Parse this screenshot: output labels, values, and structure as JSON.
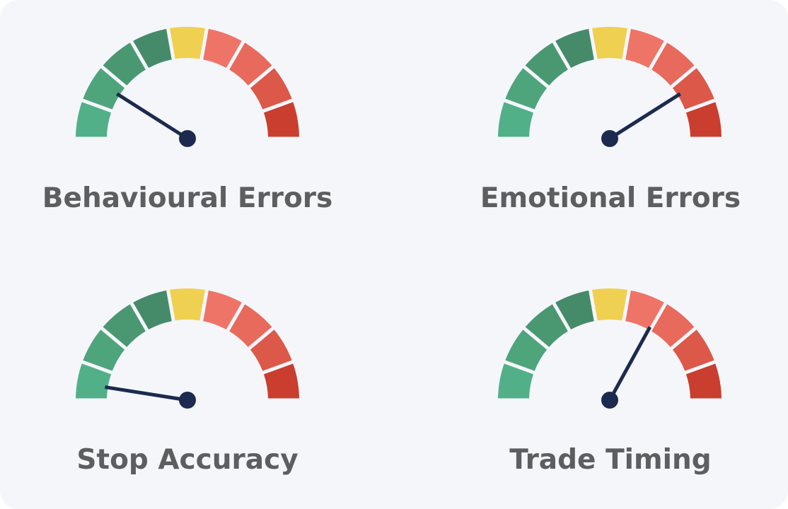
{
  "chart_data": [
    {
      "type": "gauge",
      "title": "Behavioural Errors",
      "value": 0.18,
      "range": [
        0,
        1
      ],
      "segment_colors": [
        "#52b088",
        "#4ea57c",
        "#4a9872",
        "#458b6a",
        "#f0d050",
        "#ef7468",
        "#e86a5c",
        "#dc5849",
        "#c93e2e"
      ]
    },
    {
      "type": "gauge",
      "title": "Emotional Errors",
      "value": 0.82,
      "range": [
        0,
        1
      ],
      "segment_colors": [
        "#52b088",
        "#4ea57c",
        "#4a9872",
        "#458b6a",
        "#f0d050",
        "#ef7468",
        "#e86a5c",
        "#dc5849",
        "#c93e2e"
      ]
    },
    {
      "type": "gauge",
      "title": "Stop Accuracy",
      "value": 0.05,
      "range": [
        0,
        1
      ],
      "segment_colors": [
        "#52b088",
        "#4ea57c",
        "#4a9872",
        "#458b6a",
        "#f0d050",
        "#ef7468",
        "#e86a5c",
        "#dc5849",
        "#c93e2e"
      ]
    },
    {
      "type": "gauge",
      "title": "Trade Timing",
      "value": 0.66,
      "range": [
        0,
        1
      ],
      "segment_colors": [
        "#52b088",
        "#4ea57c",
        "#4a9872",
        "#458b6a",
        "#f0d050",
        "#ef7468",
        "#e86a5c",
        "#dc5849",
        "#c93e2e"
      ]
    }
  ],
  "needle_color": "#1b2a4e",
  "label_color": "#5e5e60"
}
